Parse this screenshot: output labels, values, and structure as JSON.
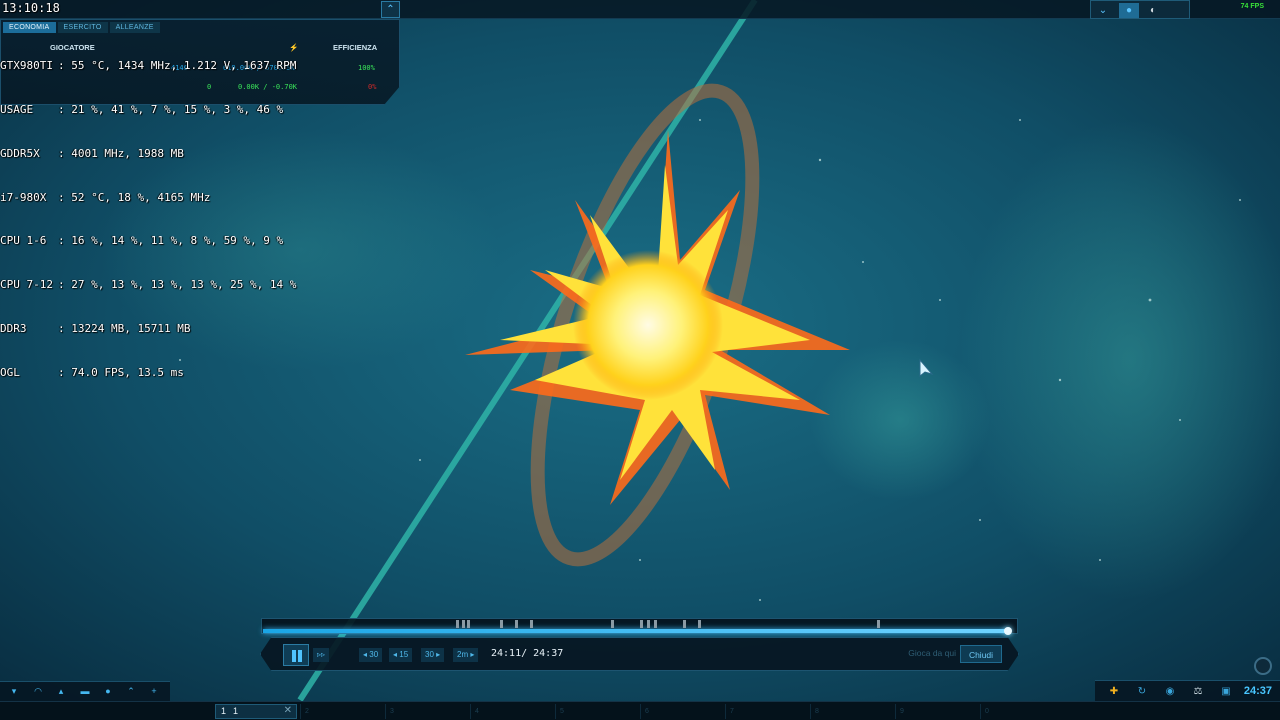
{
  "osd": {
    "clock": "13:10:18",
    "lines": [
      {
        "key": "GTX980TI",
        "value": ": 55 °C, 1434 MHz, 1.212 V, 1637 RPM"
      },
      {
        "key": "USAGE",
        "value": ": 21 %, 41 %, 7 %, 15 %, 3 %, 46 %"
      },
      {
        "key": "GDDR5X",
        "value": ": 4001 MHz, 1988 MB"
      },
      {
        "key": "i7-980X",
        "value": ": 52 °C, 18 %, 4165 MHz"
      },
      {
        "key": "CPU 1-6",
        "value": ": 16 %, 14 %, 11 %, 8 %, 59 %, 9 %"
      },
      {
        "key": "CPU 7-12",
        "value": ": 27 %, 13 %, 13 %, 13 %, 25 %, 14 %"
      },
      {
        "key": "DDR3",
        "value": ": 13224 MB, 15711 MB"
      },
      {
        "key": "OGL",
        "value": ": 74.0 FPS, 13.5 ms"
      }
    ]
  },
  "panel": {
    "tabs": [
      "ECONOMIA",
      "ESERCITO",
      "ALLEANZE"
    ],
    "col_player": "GIOCATORE",
    "col_efficiency": "EFFICIENZA",
    "row1": {
      "resources": "4146",
      "income": "610.00K / 570.75K",
      "efficiency": "100%"
    },
    "row2": {
      "resources": "0",
      "income": "0.00K / -0.70K",
      "efficiency": "0%"
    }
  },
  "topbar": {
    "fps": "74 FPS",
    "collapse_icon": "⌃"
  },
  "replay": {
    "progress": 0.988,
    "markers": [
      0.257,
      0.265,
      0.272,
      0.315,
      0.335,
      0.355,
      0.462,
      0.501,
      0.51,
      0.519,
      0.558,
      0.578,
      0.815
    ],
    "pause_label": "",
    "buttons": [
      {
        "id": "fast-forward",
        "label": "▹▹"
      },
      {
        "id": "back-30",
        "label": "◂ 30"
      },
      {
        "id": "back-15",
        "label": "◂ 15"
      },
      {
        "id": "fwd-30",
        "label": "30 ▸"
      },
      {
        "id": "fwd-2m",
        "label": "2m ▸"
      }
    ],
    "timecode": "24:11/  24:37",
    "play_here": "Gioca da qui",
    "close": "Chiudi"
  },
  "bottom": {
    "clock": "24:37",
    "group_selected": "1",
    "groups": [
      "2",
      "3",
      "4",
      "5",
      "6",
      "7",
      "8",
      "9",
      "0"
    ]
  },
  "colors": {
    "accent": "#3cc0ff",
    "fps_green": "#38e038",
    "income_blue": "#2aa9e8",
    "efficiency_green": "#3be55a",
    "efficiency_red": "#d12a2a"
  }
}
